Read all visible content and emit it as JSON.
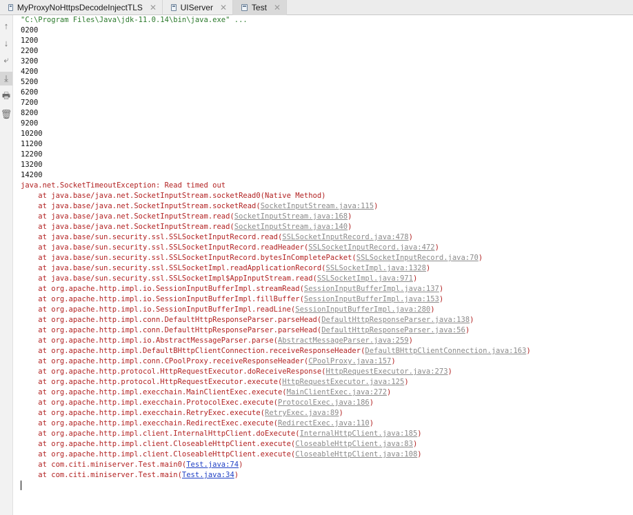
{
  "tabs": [
    {
      "label": "MyProxyNoHttpsDecodeInjectTLS",
      "active": false
    },
    {
      "label": "UIServer",
      "active": false
    },
    {
      "label": "Test",
      "active": true
    }
  ],
  "close_glyph": "✕",
  "gutter_buttons": [
    {
      "name": "scroll-up-icon",
      "glyph": "↑"
    },
    {
      "name": "scroll-down-icon",
      "glyph": "↓"
    },
    {
      "name": "soft-wrap-icon",
      "glyph": "⤶"
    },
    {
      "name": "scroll-to-end-icon",
      "glyph": "⤓"
    },
    {
      "name": "print-icon",
      "glyph": "🖶"
    },
    {
      "name": "clear-icon",
      "glyph": "🗑"
    }
  ],
  "console": {
    "command": "\"C:\\Program Files\\Java\\jdk-11.0.14\\bin\\java.exe\" ...",
    "output": [
      "0200",
      "1200",
      "2200",
      "3200",
      "4200",
      "5200",
      "6200",
      "7200",
      "8200",
      "9200",
      "10200",
      "11200",
      "12200",
      "13200",
      "14200"
    ],
    "exception": "java.net.SocketTimeoutException: Read timed out",
    "stack": [
      {
        "text": "at java.base/java.net.SocketInputStream.socketRead0(Native Method)",
        "link": ""
      },
      {
        "text": "at java.base/java.net.SocketInputStream.socketRead(",
        "link": "SocketInputStream.java:115",
        "user": false
      },
      {
        "text": "at java.base/java.net.SocketInputStream.read(",
        "link": "SocketInputStream.java:168",
        "user": false
      },
      {
        "text": "at java.base/java.net.SocketInputStream.read(",
        "link": "SocketInputStream.java:140",
        "user": false
      },
      {
        "text": "at java.base/sun.security.ssl.SSLSocketInputRecord.read(",
        "link": "SSLSocketInputRecord.java:478",
        "user": false
      },
      {
        "text": "at java.base/sun.security.ssl.SSLSocketInputRecord.readHeader(",
        "link": "SSLSocketInputRecord.java:472",
        "user": false
      },
      {
        "text": "at java.base/sun.security.ssl.SSLSocketInputRecord.bytesInCompletePacket(",
        "link": "SSLSocketInputRecord.java:70",
        "user": false
      },
      {
        "text": "at java.base/sun.security.ssl.SSLSocketImpl.readApplicationRecord(",
        "link": "SSLSocketImpl.java:1328",
        "user": false
      },
      {
        "text": "at java.base/sun.security.ssl.SSLSocketImpl$AppInputStream.read(",
        "link": "SSLSocketImpl.java:971",
        "user": false
      },
      {
        "text": "at org.apache.http.impl.io.SessionInputBufferImpl.streamRead(",
        "link": "SessionInputBufferImpl.java:137",
        "user": false
      },
      {
        "text": "at org.apache.http.impl.io.SessionInputBufferImpl.fillBuffer(",
        "link": "SessionInputBufferImpl.java:153",
        "user": false
      },
      {
        "text": "at org.apache.http.impl.io.SessionInputBufferImpl.readLine(",
        "link": "SessionInputBufferImpl.java:280",
        "user": false
      },
      {
        "text": "at org.apache.http.impl.conn.DefaultHttpResponseParser.parseHead(",
        "link": "DefaultHttpResponseParser.java:138",
        "user": false
      },
      {
        "text": "at org.apache.http.impl.conn.DefaultHttpResponseParser.parseHead(",
        "link": "DefaultHttpResponseParser.java:56",
        "user": false
      },
      {
        "text": "at org.apache.http.impl.io.AbstractMessageParser.parse(",
        "link": "AbstractMessageParser.java:259",
        "user": false
      },
      {
        "text": "at org.apache.http.impl.DefaultBHttpClientConnection.receiveResponseHeader(",
        "link": "DefaultBHttpClientConnection.java:163",
        "user": false
      },
      {
        "text": "at org.apache.http.impl.conn.CPoolProxy.receiveResponseHeader(",
        "link": "CPoolProxy.java:157",
        "user": false
      },
      {
        "text": "at org.apache.http.protocol.HttpRequestExecutor.doReceiveResponse(",
        "link": "HttpRequestExecutor.java:273",
        "user": false
      },
      {
        "text": "at org.apache.http.protocol.HttpRequestExecutor.execute(",
        "link": "HttpRequestExecutor.java:125",
        "user": false
      },
      {
        "text": "at org.apache.http.impl.execchain.MainClientExec.execute(",
        "link": "MainClientExec.java:272",
        "user": false
      },
      {
        "text": "at org.apache.http.impl.execchain.ProtocolExec.execute(",
        "link": "ProtocolExec.java:186",
        "user": false
      },
      {
        "text": "at org.apache.http.impl.execchain.RetryExec.execute(",
        "link": "RetryExec.java:89",
        "user": false
      },
      {
        "text": "at org.apache.http.impl.execchain.RedirectExec.execute(",
        "link": "RedirectExec.java:110",
        "user": false
      },
      {
        "text": "at org.apache.http.impl.client.InternalHttpClient.doExecute(",
        "link": "InternalHttpClient.java:185",
        "user": false
      },
      {
        "text": "at org.apache.http.impl.client.CloseableHttpClient.execute(",
        "link": "CloseableHttpClient.java:83",
        "user": false
      },
      {
        "text": "at org.apache.http.impl.client.CloseableHttpClient.execute(",
        "link": "CloseableHttpClient.java:108",
        "user": false
      },
      {
        "text": "at com.citi.miniserver.Test.main0(",
        "link": "Test.java:74",
        "user": true
      },
      {
        "text": "at com.citi.miniserver.Test.main(",
        "link": "Test.java:34",
        "user": true
      }
    ]
  }
}
